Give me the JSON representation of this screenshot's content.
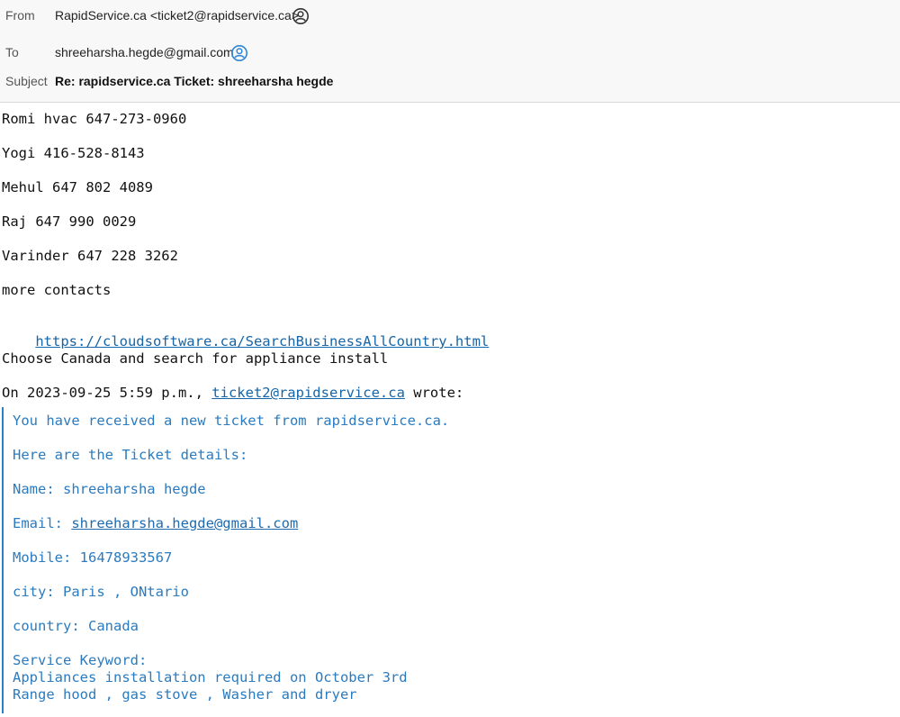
{
  "header": {
    "from_label": "From",
    "from_value": "RapidService.ca <ticket2@rapidservice.ca>",
    "to_label": "To",
    "to_value": "shreeharsha.hegde@gmail.com",
    "subject_label": "Subject",
    "subject_value": "Re: rapidservice.ca Ticket: shreeharsha hegde"
  },
  "reply": {
    "contacts": [
      "Romi hvac 647-273-0960",
      "Yogi 416-528-8143",
      "Mehul 647 802 4089",
      "Raj 647 990 0029",
      "Varinder 647 228 3262"
    ],
    "more_contacts": "more contacts",
    "link": "https://cloudsoftware.ca/SearchBusinessAllCountry.html",
    "instruction": "Choose Canada and search for appliance install",
    "wrote_prefix": "On 2023-09-25 5:59 p.m., ",
    "wrote_email": "ticket2@rapidservice.ca",
    "wrote_suffix": " wrote:"
  },
  "quoted": {
    "intro": "You have received a new ticket from rapidservice.ca.",
    "details_heading": "Here are the Ticket details:",
    "name": "Name: shreeharsha hegde",
    "email_label": "Email: ",
    "email_value": "shreeharsha.hegde@gmail.com",
    "mobile": "Mobile: 16478933567",
    "city": "city: Paris , ONtario",
    "country": "country: Canada",
    "service_keyword": "Service Keyword:",
    "service_line1": "Appliances installation required on October 3rd",
    "service_line2": "Range hood , gas stove , Washer and dryer"
  },
  "colors": {
    "quote_text": "#2a7bc0",
    "quote_bar": "#2f7fc4",
    "link": "#1565a8",
    "header_bg": "#f8f8f8"
  },
  "icons": {
    "from_contact": "person-circle-icon",
    "to_contact": "person-circle-blue-icon"
  }
}
